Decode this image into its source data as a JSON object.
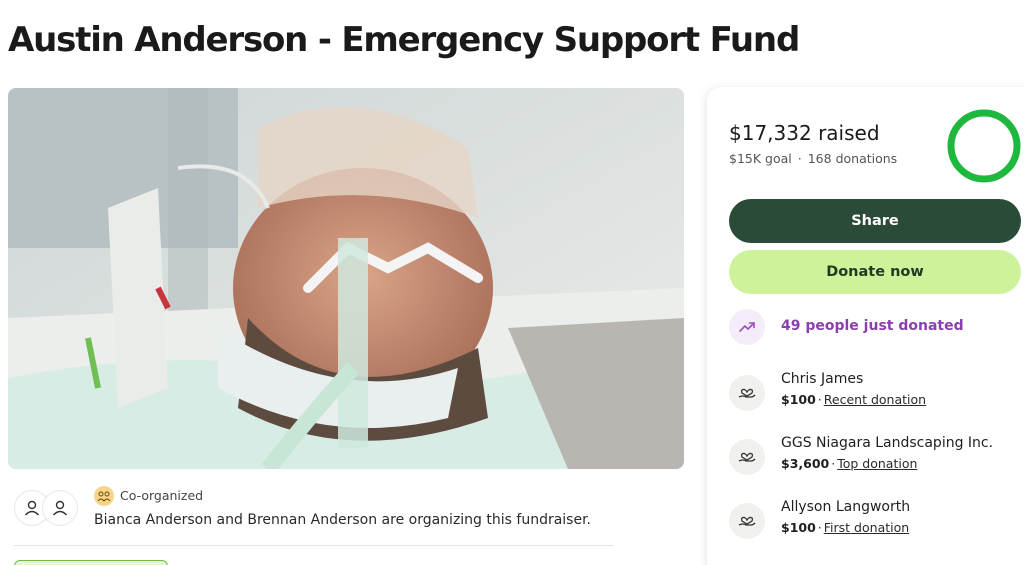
{
  "page": {
    "title": "Austin Anderson - Emergency Support Fund"
  },
  "hero": {
    "image": "photo of patient in hospital bed with breathing tube and neck brace"
  },
  "organizer": {
    "badge_label": "Co-organized",
    "text": "Bianca Anderson and Brennan Anderson are organizing this fundraiser."
  },
  "progress": {
    "raised": "$17,332 raised",
    "goal": "$15K goal",
    "separator": "·",
    "donations": "168 donations",
    "fraction": 1.0,
    "ring_color": "#1fb83f"
  },
  "actions": {
    "share": "Share",
    "donate": "Donate now"
  },
  "trend": {
    "text": "49 people just donated",
    "icon": "trending-up-icon"
  },
  "donations": [
    {
      "name": "Chris James",
      "amount": "$100",
      "sep": "·",
      "label": "Recent donation",
      "icon": "heart-hand-icon"
    },
    {
      "name": "GGS Niagara Landscaping Inc.",
      "amount": "$3,600",
      "sep": "·",
      "label": "Top donation",
      "icon": "heart-hand-icon"
    },
    {
      "name": "Allyson Langworth",
      "amount": "$100",
      "sep": "·",
      "label": "First donation",
      "icon": "heart-hand-icon"
    }
  ],
  "colors": {
    "share_bg": "#2a4b37",
    "donate_bg": "#cdf29a",
    "trend_text": "#8a3fb0"
  }
}
